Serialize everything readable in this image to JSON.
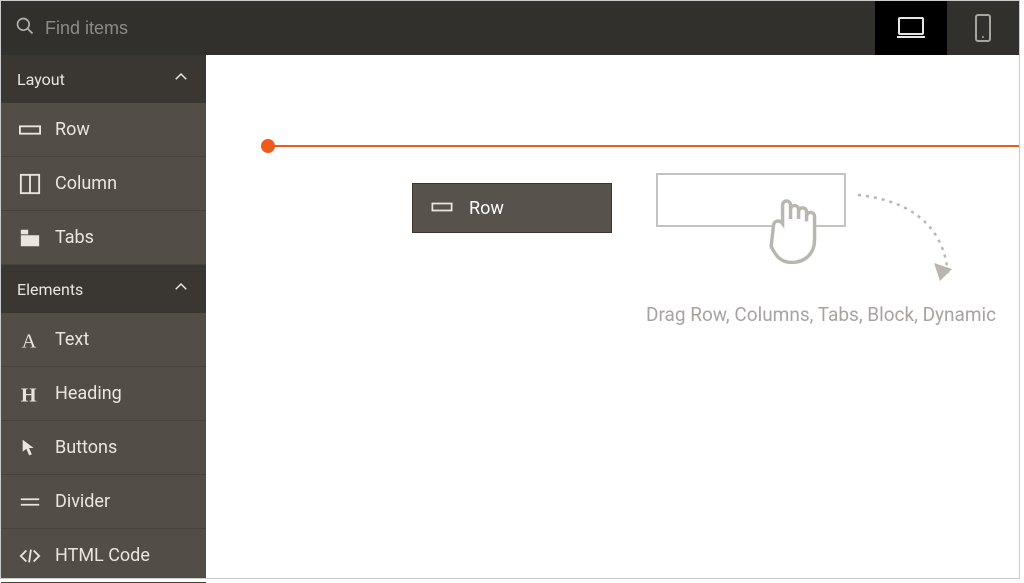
{
  "topbar": {
    "search_placeholder": "Find items"
  },
  "device_toggle": {
    "desktop_name": "desktop",
    "mobile_name": "mobile",
    "active": "desktop"
  },
  "sidebar": {
    "sections": [
      {
        "title": "Layout",
        "expanded": true,
        "items": [
          {
            "label": "Row",
            "icon": "row-icon"
          },
          {
            "label": "Column",
            "icon": "column-icon"
          },
          {
            "label": "Tabs",
            "icon": "tabs-icon"
          }
        ]
      },
      {
        "title": "Elements",
        "expanded": true,
        "items": [
          {
            "label": "Text",
            "icon": "text-icon"
          },
          {
            "label": "Heading",
            "icon": "heading-icon"
          },
          {
            "label": "Buttons",
            "icon": "buttons-icon"
          },
          {
            "label": "Divider",
            "icon": "divider-icon"
          },
          {
            "label": "HTML Code",
            "icon": "html-code-icon"
          }
        ]
      }
    ]
  },
  "canvas": {
    "dragging_chip_label": "Row",
    "guide_color": "#ef5b1b",
    "dropzone_hint": "Drag Row, Columns, Tabs, Block, Dynamic"
  }
}
